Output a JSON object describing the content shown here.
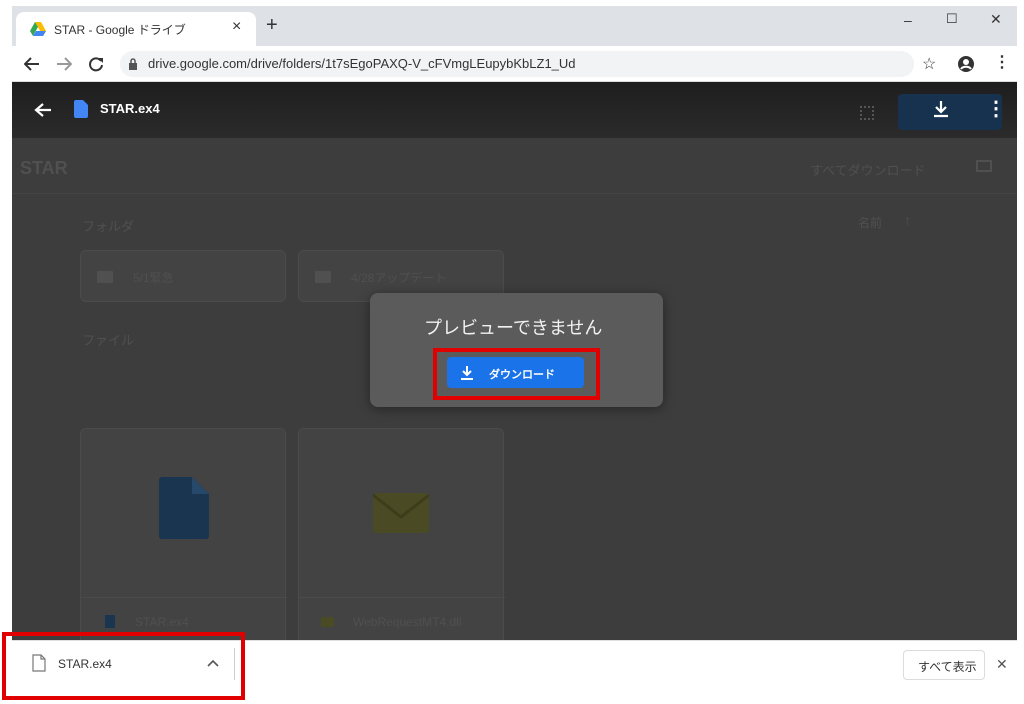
{
  "browser": {
    "tab_title": "STAR - Google ドライブ",
    "tab_close": "×",
    "new_tab": "+",
    "url": "drive.google.com/drive/folders/1t7sEgoPAXQ-V_cFVmgLEupybKbLZ1_Ud",
    "window_controls": {
      "minimize": "–",
      "maximize": "☐",
      "close": "✕"
    }
  },
  "viewer": {
    "file_name": "STAR.ex4"
  },
  "drive": {
    "folder_title": "STAR",
    "download_all": "すべてダウンロード",
    "sort_label": "名前",
    "section_folders": "フォルダ",
    "folders": [
      "5/1緊急",
      "4/28アップデート"
    ],
    "section_files": "ファイル",
    "files": [
      "STAR.ex4",
      "WebRequestMT4.dll"
    ]
  },
  "dialog": {
    "message": "プレビューできません",
    "download_label": "ダウンロード"
  },
  "shelf": {
    "file_name": "STAR.ex4",
    "show_all": "すべて表示",
    "close": "✕"
  },
  "colors": {
    "accent": "#1a73e8",
    "highlight": "#e00000"
  }
}
